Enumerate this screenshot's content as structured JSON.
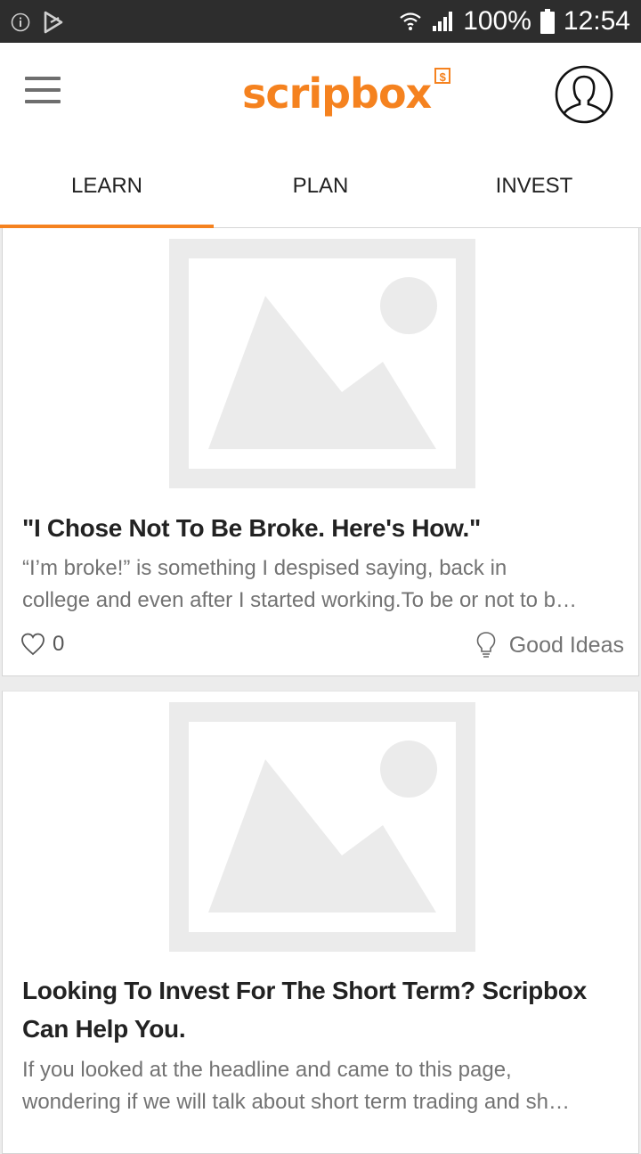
{
  "status_bar": {
    "battery": "100%",
    "time": "12:54"
  },
  "app": {
    "logo": "scripbox",
    "logo_badge": "$"
  },
  "tabs": [
    {
      "label": "LEARN",
      "active": true
    },
    {
      "label": "PLAN",
      "active": false
    },
    {
      "label": "INVEST",
      "active": false
    }
  ],
  "articles": [
    {
      "title": "\"I Chose Not To Be Broke. Here's How.\"",
      "excerpt_line1": "“I’m broke!” is something I despised saying, back in",
      "excerpt_line2": "college and even after I started working.To be or not to b…",
      "likes": "0",
      "category": "Good Ideas",
      "category_icon": "lightbulb-icon"
    },
    {
      "title_line1": "Looking To Invest For The Short Term? Scripbox",
      "title_line2": "Can Help You.",
      "excerpt_line1": "If you looked at the headline and came to this page,",
      "excerpt_line2": "wondering if we will talk about short term trading and sh…"
    }
  ],
  "colors": {
    "brand": "#f5821f",
    "status_bar": "#2d2d2d",
    "placeholder": "#ebebeb"
  }
}
